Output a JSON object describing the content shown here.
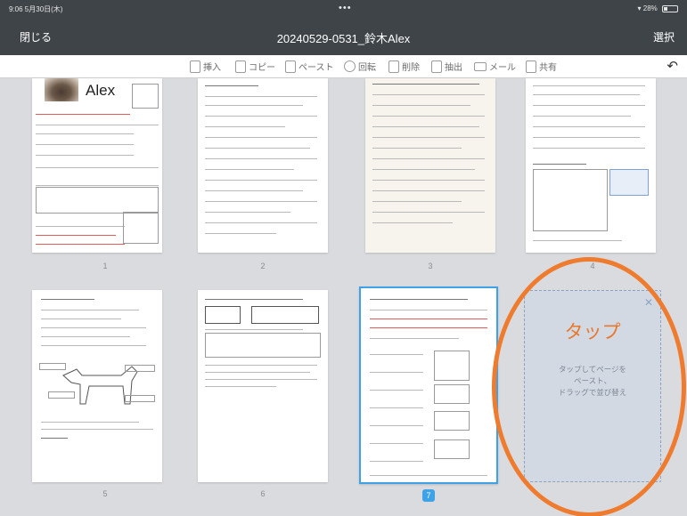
{
  "status_bar": {
    "time": "9:06 5月30日(木)",
    "dots": "•••",
    "battery": "28%"
  },
  "header": {
    "close_label": "閉じる",
    "title": "20240529-0531_鈴木Alex",
    "select_label": "選択"
  },
  "toolbar": {
    "items": [
      {
        "label": "挿入",
        "icon": "insert-icon"
      },
      {
        "label": "コピー",
        "icon": "copy-icon"
      },
      {
        "label": "ペースト",
        "icon": "paste-icon"
      },
      {
        "label": "回転",
        "icon": "rotate-icon"
      },
      {
        "label": "削除",
        "icon": "trash-icon"
      },
      {
        "label": "抽出",
        "icon": "extract-icon"
      },
      {
        "label": "メール",
        "icon": "mail-icon"
      },
      {
        "label": "共有",
        "icon": "share-icon"
      }
    ],
    "undo_icon": "undo-icon"
  },
  "pages": [
    {
      "number": "1",
      "heading": "Alex"
    },
    {
      "number": "2"
    },
    {
      "number": "3"
    },
    {
      "number": "4"
    },
    {
      "number": "5"
    },
    {
      "number": "6"
    },
    {
      "number": "7",
      "selected": true
    }
  ],
  "drop_zone": {
    "title": "タップ",
    "text": "タップしてページを\nペースト、\nドラッグで並び替え"
  },
  "colors": {
    "accent": "#3ea2e8",
    "highlight": "#ef7b2e",
    "topbar": "#3f4448"
  }
}
